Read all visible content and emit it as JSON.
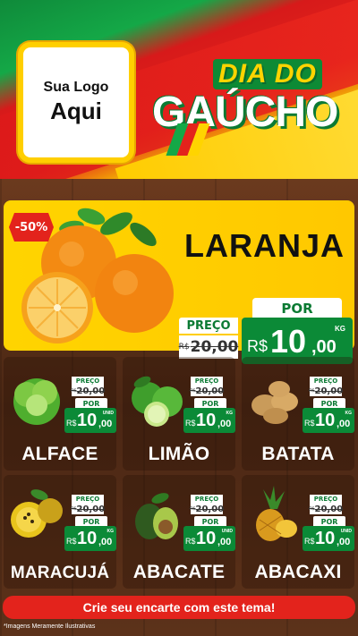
{
  "header": {
    "logo_line1": "Sua Logo",
    "logo_line2": "Aqui",
    "title_top": "DIA DO",
    "title_main": "GAÚCHO",
    "colors": {
      "green": "#14a847",
      "red": "#e3231c",
      "yellow": "#ffd400"
    }
  },
  "featured": {
    "discount": "-50%",
    "name": "LARANJA",
    "preco_label": "PREÇO",
    "old_currency": "R$",
    "old_price": "20,00",
    "por_label": "POR",
    "currency": "R$",
    "price_int": "10",
    "price_dec": ",00",
    "unit": "KG"
  },
  "products": [
    {
      "name": "ALFACE",
      "preco_label": "PREÇO",
      "old_currency": "R$",
      "old_price": "20,00",
      "por_label": "POR",
      "currency": "R$",
      "price_int": "10",
      "price_dec": ",00",
      "unit": "UNID",
      "icon": "lettuce-icon"
    },
    {
      "name": "LIMÃO",
      "preco_label": "PREÇO",
      "old_currency": "R$",
      "old_price": "20,00",
      "por_label": "POR",
      "currency": "R$",
      "price_int": "10",
      "price_dec": ",00",
      "unit": "KG",
      "icon": "lime-icon"
    },
    {
      "name": "BATATA",
      "preco_label": "PREÇO",
      "old_currency": "R$",
      "old_price": "20,00",
      "por_label": "POR",
      "currency": "R$",
      "price_int": "10",
      "price_dec": ",00",
      "unit": "KG",
      "icon": "potato-icon"
    },
    {
      "name": "MARACUJÁ",
      "preco_label": "PREÇO",
      "old_currency": "R$",
      "old_price": "20,00",
      "por_label": "POR",
      "currency": "R$",
      "price_int": "10",
      "price_dec": ",00",
      "unit": "KG",
      "icon": "passionfruit-icon"
    },
    {
      "name": "ABACATE",
      "preco_label": "PREÇO",
      "old_currency": "R$",
      "old_price": "20,00",
      "por_label": "POR",
      "currency": "R$",
      "price_int": "10",
      "price_dec": ",00",
      "unit": "UNID",
      "icon": "avocado-icon"
    },
    {
      "name": "ABACAXI",
      "preco_label": "PREÇO",
      "old_currency": "R$",
      "old_price": "20,00",
      "por_label": "POR",
      "currency": "R$",
      "price_int": "10",
      "price_dec": ",00",
      "unit": "UNID",
      "icon": "pineapple-icon"
    }
  ],
  "cta": "Crie seu encarte com este tema!",
  "disclaimer": "*Imagens Meramente Ilustrativas"
}
